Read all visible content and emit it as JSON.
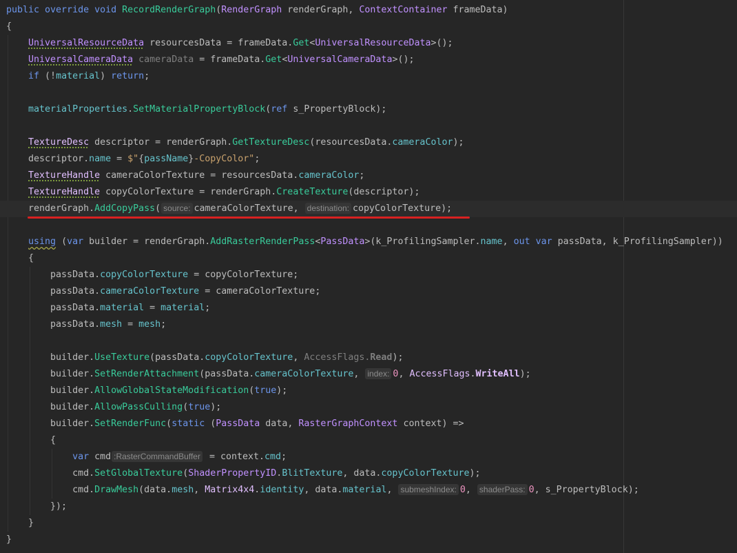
{
  "theme": {
    "background": "#262626",
    "current_line": "#2c2c2c",
    "text": "#bdbdbd",
    "keyword": "#6c95eb",
    "method": "#39cc9b",
    "class": "#c191ff",
    "struct": "#e1bfff",
    "member": "#66c3cc",
    "string": "#c9a26d",
    "number": "#ed94c0",
    "unused": "#7f7f7f",
    "hint_text": "#8c8c8c",
    "hint_background": "#363636",
    "suggestion_underline": "#7d9a3e",
    "warning_underline": "#a5a54a",
    "right_margin": "#383838",
    "indent_guide": "#343434"
  },
  "caret_line": 12,
  "annotation_underline": {
    "line": 12,
    "color": "#d92121"
  },
  "editor": {
    "lines": [
      [
        {
          "keyword": "public override void "
        },
        {
          "method": "RecordRenderGraph"
        },
        {
          "plain": "("
        },
        {
          "class": "RenderGraph"
        },
        {
          "plain": " renderGraph, "
        },
        {
          "class": "ContextContainer"
        },
        {
          "plain": " frameData)"
        }
      ],
      [
        {
          "plain": "{"
        }
      ],
      [
        {
          "plain": "    "
        },
        {
          "class": "UniversalResourceData",
          "suggestion": true
        },
        {
          "plain": " resourcesData = frameData."
        },
        {
          "method": "Get"
        },
        {
          "plain": "<"
        },
        {
          "class": "UniversalResourceData"
        },
        {
          "plain": ">();"
        }
      ],
      [
        {
          "plain": "    "
        },
        {
          "class": "UniversalCameraData",
          "suggestion": true
        },
        {
          "plain": " "
        },
        {
          "unused": "cameraData"
        },
        {
          "plain": " = frameData."
        },
        {
          "method": "Get"
        },
        {
          "plain": "<"
        },
        {
          "class": "UniversalCameraData"
        },
        {
          "plain": ">();"
        }
      ],
      [
        {
          "keyword": "    if"
        },
        {
          "plain": " (!"
        },
        {
          "member": "material"
        },
        {
          "plain": ") "
        },
        {
          "keyword": "return"
        },
        {
          "plain": ";"
        }
      ],
      [],
      [
        {
          "member": "    materialProperties"
        },
        {
          "plain": "."
        },
        {
          "method": "SetMaterialPropertyBlock"
        },
        {
          "plain": "("
        },
        {
          "keyword": "ref"
        },
        {
          "plain": " s_PropertyBlock);"
        }
      ],
      [],
      [
        {
          "plain": "    "
        },
        {
          "struct": "TextureDesc",
          "suggestion": true
        },
        {
          "plain": " descriptor = renderGraph."
        },
        {
          "method": "GetTextureDesc"
        },
        {
          "plain": "(resourcesData."
        },
        {
          "member": "cameraColor"
        },
        {
          "plain": ");"
        }
      ],
      [
        {
          "plain": "    descriptor."
        },
        {
          "member": "name"
        },
        {
          "plain": " = "
        },
        {
          "string": "$\""
        },
        {
          "plain": "{"
        },
        {
          "member": "passName"
        },
        {
          "plain": "}"
        },
        {
          "string": "-CopyColor\""
        },
        {
          "plain": ";"
        }
      ],
      [
        {
          "plain": "    "
        },
        {
          "struct": "TextureHandle",
          "suggestion": true
        },
        {
          "plain": " cameraColorTexture = resourcesData."
        },
        {
          "member": "cameraColor"
        },
        {
          "plain": ";"
        }
      ],
      [
        {
          "plain": "    "
        },
        {
          "struct": "TextureHandle",
          "suggestion": true
        },
        {
          "plain": " copyColorTexture = renderGraph."
        },
        {
          "method": "CreateTexture"
        },
        {
          "plain": "(descriptor);"
        }
      ],
      [
        {
          "plain": "    renderGraph."
        },
        {
          "method": "AddCopyPass"
        },
        {
          "plain": "("
        },
        {
          "hint": "source:"
        },
        {
          "plain": "cameraColorTexture, "
        },
        {
          "hint": "destination:"
        },
        {
          "plain": "copyColorTexture);"
        }
      ],
      [],
      [
        {
          "plain": "    "
        },
        {
          "keyword": "using",
          "warning": true
        },
        {
          "plain": " ("
        },
        {
          "keyword": "var"
        },
        {
          "plain": " builder = renderGraph."
        },
        {
          "method": "AddRasterRenderPass"
        },
        {
          "plain": "<"
        },
        {
          "class": "PassData"
        },
        {
          "plain": ">(k_ProfilingSampler."
        },
        {
          "member": "name"
        },
        {
          "plain": ", "
        },
        {
          "keyword": "out var"
        },
        {
          "plain": " passData, k_ProfilingSampler))"
        }
      ],
      [
        {
          "plain": "    {"
        }
      ],
      [
        {
          "plain": "        passData."
        },
        {
          "member": "copyColorTexture"
        },
        {
          "plain": " = copyColorTexture;"
        }
      ],
      [
        {
          "plain": "        passData."
        },
        {
          "member": "cameraColorTexture"
        },
        {
          "plain": " = cameraColorTexture;"
        }
      ],
      [
        {
          "plain": "        passData."
        },
        {
          "member": "material"
        },
        {
          "plain": " = "
        },
        {
          "member": "material"
        },
        {
          "plain": ";"
        }
      ],
      [
        {
          "plain": "        passData."
        },
        {
          "member": "mesh"
        },
        {
          "plain": " = "
        },
        {
          "member": "mesh"
        },
        {
          "plain": ";"
        }
      ],
      [],
      [
        {
          "plain": "        builder."
        },
        {
          "method": "UseTexture"
        },
        {
          "plain": "(passData."
        },
        {
          "member": "copyColorTexture"
        },
        {
          "plain": ", "
        },
        {
          "redundant": "AccessFlags."
        },
        {
          "enum_member": "Read",
          "dim": true
        },
        {
          "plain": ");"
        }
      ],
      [
        {
          "plain": "        builder."
        },
        {
          "method": "SetRenderAttachment"
        },
        {
          "plain": "(passData."
        },
        {
          "member": "cameraColorTexture"
        },
        {
          "plain": ", "
        },
        {
          "hint": "index:"
        },
        {
          "number": "0"
        },
        {
          "plain": ", "
        },
        {
          "struct": "AccessFlags"
        },
        {
          "plain": "."
        },
        {
          "enum_member": "WriteAll"
        },
        {
          "plain": ");"
        }
      ],
      [
        {
          "plain": "        builder."
        },
        {
          "method": "AllowGlobalStateModification"
        },
        {
          "plain": "("
        },
        {
          "keyword": "true"
        },
        {
          "plain": ");"
        }
      ],
      [
        {
          "plain": "        builder."
        },
        {
          "method": "AllowPassCulling"
        },
        {
          "plain": "("
        },
        {
          "keyword": "true"
        },
        {
          "plain": ");"
        }
      ],
      [
        {
          "plain": "        builder."
        },
        {
          "method": "SetRenderFunc"
        },
        {
          "plain": "("
        },
        {
          "keyword": "static"
        },
        {
          "plain": " ("
        },
        {
          "class": "PassData"
        },
        {
          "plain": " data, "
        },
        {
          "class": "RasterGraphContext"
        },
        {
          "plain": " context) =>"
        }
      ],
      [
        {
          "plain": "        {"
        }
      ],
      [
        {
          "keyword": "            var"
        },
        {
          "plain": " cmd"
        },
        {
          "hint": ":RasterCommandBuffer"
        },
        {
          "plain": " = context."
        },
        {
          "member": "cmd"
        },
        {
          "plain": ";"
        }
      ],
      [
        {
          "plain": "            cmd."
        },
        {
          "method": "SetGlobalTexture"
        },
        {
          "plain": "("
        },
        {
          "class": "ShaderPropertyID"
        },
        {
          "plain": "."
        },
        {
          "member": "BlitTexture"
        },
        {
          "plain": ", data."
        },
        {
          "member": "copyColorTexture"
        },
        {
          "plain": ");"
        }
      ],
      [
        {
          "plain": "            cmd."
        },
        {
          "method": "DrawMesh"
        },
        {
          "plain": "(data."
        },
        {
          "member": "mesh"
        },
        {
          "plain": ", "
        },
        {
          "struct": "Matrix4x4"
        },
        {
          "plain": "."
        },
        {
          "member": "identity"
        },
        {
          "plain": ", data."
        },
        {
          "member": "material"
        },
        {
          "plain": ", "
        },
        {
          "hint": "submeshIndex:"
        },
        {
          "number": "0"
        },
        {
          "plain": ", "
        },
        {
          "hint": "shaderPass:"
        },
        {
          "number": "0"
        },
        {
          "plain": ", s_PropertyBlock);"
        }
      ],
      [
        {
          "plain": "        });"
        }
      ],
      [
        {
          "plain": "    }"
        }
      ],
      [
        {
          "plain": "}"
        }
      ]
    ]
  }
}
